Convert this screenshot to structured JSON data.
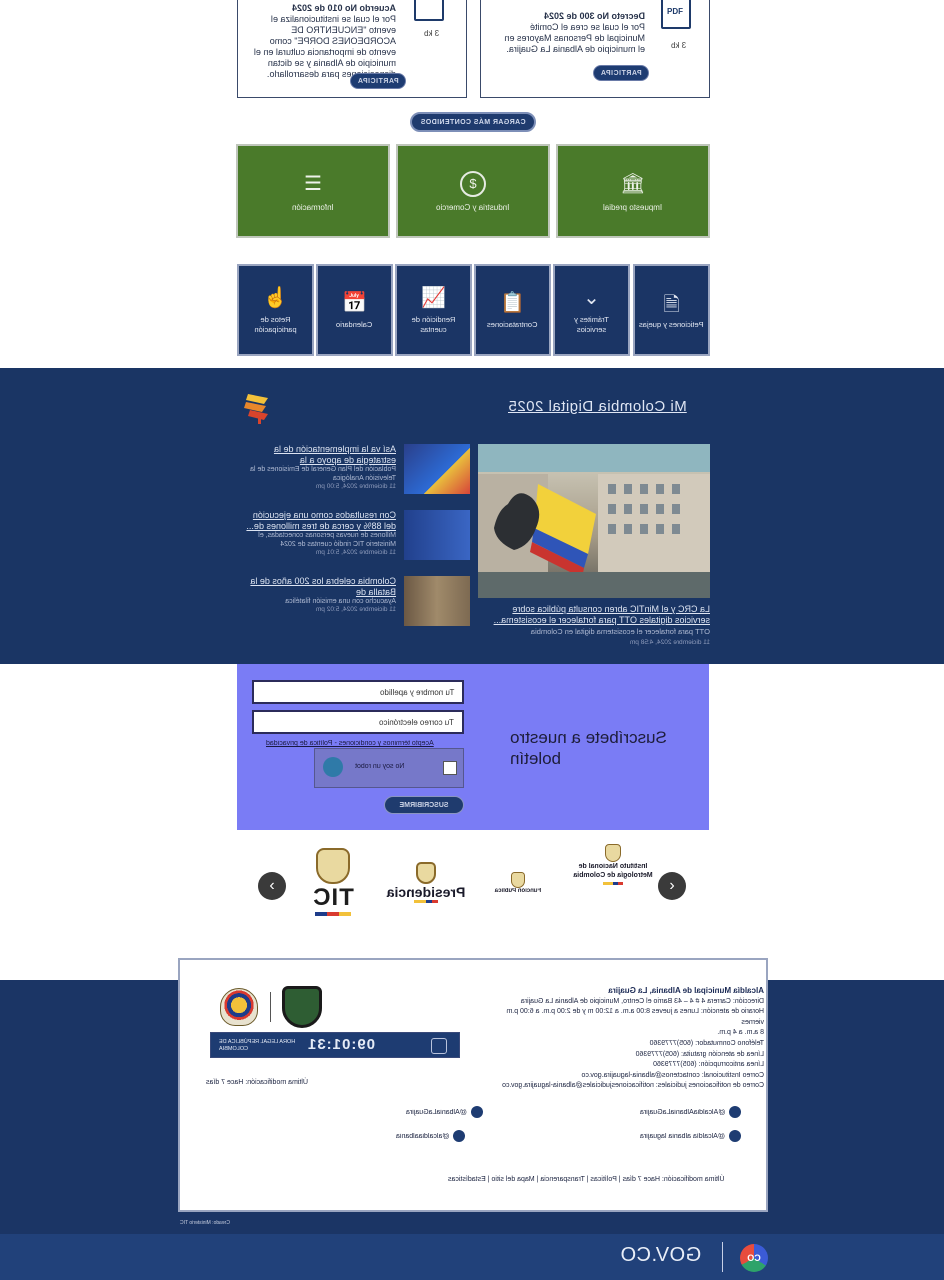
{
  "docs": [
    {
      "title": "Acuerdo No 010 de 2024",
      "body": "Por el cual se institucionaliza el evento \"ENCUENTRO DE ACORDEONES DORPE\" como evento de importancia cultural en el municipio de Albania y se dictan disposiciones para desarrollarlo.",
      "size": "3 kb",
      "button": "PARTICIPA"
    },
    {
      "title": "Decreto No 300 de 2024",
      "body": "Por el cual se crea el Comité Municipal de Personas Mayores en el municipio de Albania La Guajira.",
      "size": "3 kb",
      "button": "PARTICIPA"
    }
  ],
  "pdf_label": "PDF",
  "load_more": "CARGAR MÁS CONTENIDOS",
  "green_tiles": [
    {
      "icon": "bank-icon",
      "label": "Impuesto predial"
    },
    {
      "icon": "dollar-icon",
      "label": "Industria y Comercio"
    },
    {
      "icon": "document-icon",
      "label": "Información"
    }
  ],
  "blue_tiles": [
    {
      "icon": "file-icon",
      "label": "Peticiones y quejas"
    },
    {
      "icon": "chevron-down-icon",
      "label": "Trámites y servicios"
    },
    {
      "icon": "clipboard-icon",
      "label": "Contrataciones"
    },
    {
      "icon": "chart-icon",
      "label": "Rendición de cuentas"
    },
    {
      "icon": "calendar-icon",
      "label": "Calendario"
    },
    {
      "icon": "hand-icon",
      "label": "Retos de participación"
    }
  ],
  "news": {
    "section_title": "Mi Colombia Digital 2025",
    "hero": {
      "title": "La CRC y el MinTIC abren consulta pública sobre servicios digitales OTT para fortalecer el ecosistema...",
      "summary": "OTT para fortalecer el ecosistema digital en Colombia",
      "date": "11 diciembre 2024, 4:58 pm"
    },
    "items": [
      {
        "title": "Así va la implementación de la estrategia de apoyo a la",
        "summary": "Población del Plan General de Emisiones de la Televisión Analógica",
        "date": "11 diciembre 2024, 5:00 pm"
      },
      {
        "title": "Con resultados como una ejecución del 88% y cerca de tres millones de...",
        "summary": "Millones de nuevas personas conectadas, el Ministerio TIC rindió cuentas de 2024",
        "date": "11 diciembre 2024, 5:01 pm"
      },
      {
        "title": "Colombia celebra los 200 años de la Batalla de",
        "summary": "Ayacucho con una emisión filatélica",
        "date": "11 diciembre 2024, 5:02 pm"
      }
    ]
  },
  "newsletter": {
    "title": "Suscríbete a nuestro boletín",
    "name_placeholder": "Tu nombre y apellido",
    "email_placeholder": "Tu correo electrónico",
    "terms": "Acepto términos y condiciones - Política de privacidad",
    "captcha": "No soy un robot",
    "subscribe": "SUSCRIBIRME"
  },
  "partners": {
    "tic": "TIC",
    "presidencia": "Presidencia",
    "sector": "Función Pública",
    "igac": "Instituto Nacional de Metrología de Colombia"
  },
  "footer": {
    "entity": "Alcaldía Municipal de Albania, La Guajira",
    "lines": [
      "Dirección: Carrera 4 # 4 – 43 Barrio el Centro, Municipio de Albania La Guajira",
      "Horario de atención: Lunes a jueves 8:00 a.m. a 12:00 m y de 2:00 p.m. a 6:00 p.m viernes",
      "8 a.m. a 4 p.m.",
      "Teléfono Conmutador: (605)7779360",
      "Línea de atención gratuita: (605)7779360",
      "Línea anticorrupción: (605)7779360",
      "Correo Institucional: contactenos@albania-laguajira.gov.co",
      "Correo de notificaciones judiciales: notificacionesjudiciales@albania-laguajira.gov.co"
    ],
    "clock_time": "09:01:31",
    "clock_label": "HORA LEGAL REPÚBLICA DE COLOMBIA",
    "updated": "Última modificación: Hace 7 días",
    "socials": [
      "@AlcaldiaAlbaniaLaGuajira",
      "@AlbaniaLaGuajira",
      "@Alcaldía albania laguajira",
      "@alcaldiaalbania"
    ],
    "links": "Última modificación: Hace 7 días  |  Políticas  |  Transparencia  |  Mapa del sitio  |  Estadísticas",
    "note": "Creado: Ministerio TIC"
  },
  "gov": {
    "brand": "GOV.CO",
    "badge": "CO"
  },
  "colors": {
    "primary_blue": "#1b3565",
    "green": "#4a7a2a",
    "newsletter": "#7a7cf5"
  }
}
